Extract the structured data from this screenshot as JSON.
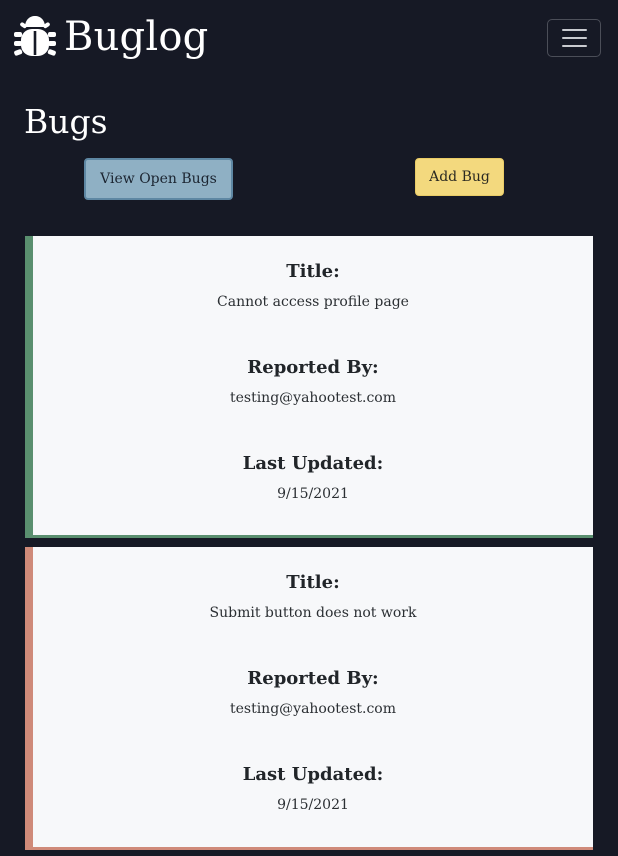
{
  "navbar": {
    "brand_icon": "bug-icon",
    "brand_text": "Buglog",
    "toggler_icon": "hamburger-menu-icon"
  },
  "page": {
    "title": "Bugs"
  },
  "actions": {
    "view_open_label": "View Open Bugs",
    "add_bug_label": "Add Bug"
  },
  "colors": {
    "background": "#161925",
    "card_background": "#f7f8fa",
    "open_accent": "#5a8f6f",
    "closed_accent": "#cf8a79",
    "view_open_button": "#8fb0c4",
    "add_bug_button": "#f3d97e"
  },
  "labels": {
    "title": "Title:",
    "reported_by": "Reported By:",
    "last_updated": "Last Updated:"
  },
  "bugs": [
    {
      "title": "Cannot access profile page",
      "reported_by": "testing@yahootest.com",
      "last_updated": "9/15/2021",
      "accent": "green"
    },
    {
      "title": "Submit button does not work",
      "reported_by": "testing@yahootest.com",
      "last_updated": "9/15/2021",
      "accent": "red"
    }
  ]
}
